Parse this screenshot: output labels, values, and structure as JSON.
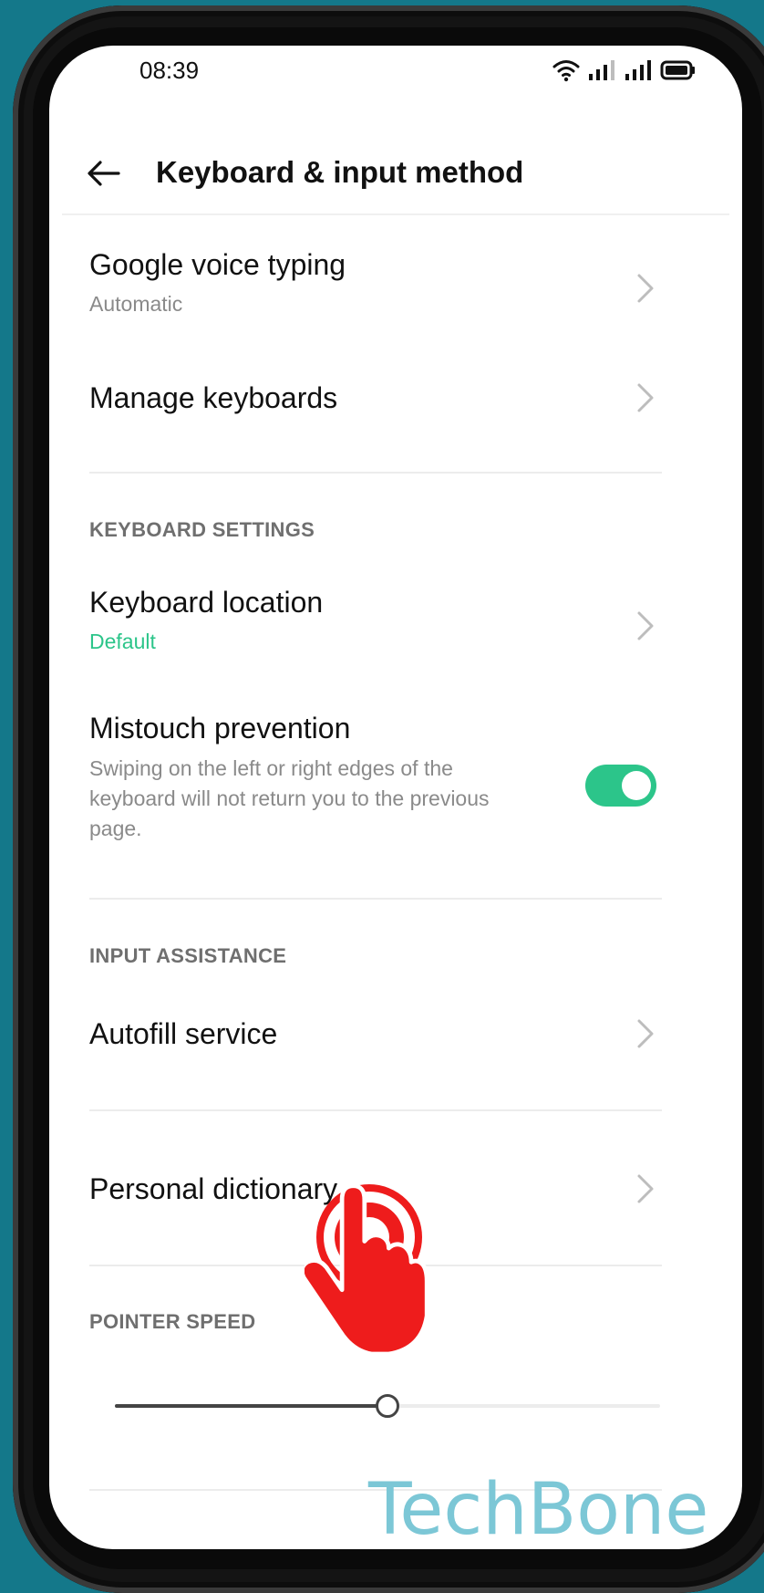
{
  "status_bar": {
    "time": "08:39"
  },
  "header": {
    "title": "Keyboard & input method"
  },
  "rows": {
    "google_voice": {
      "title": "Google voice typing",
      "subtitle": "Automatic"
    },
    "manage_keyboards": {
      "title": "Manage keyboards"
    },
    "keyboard_location": {
      "title": "Keyboard location",
      "subtitle": "Default"
    },
    "mistouch": {
      "title": "Mistouch prevention",
      "description": "Swiping on the left or right edges of the keyboard will not return you to the previous page.",
      "enabled": true
    },
    "autofill": {
      "title": "Autofill service"
    },
    "personal_dictionary": {
      "title": "Personal dictionary"
    }
  },
  "sections": {
    "keyboard_settings": "KEYBOARD SETTINGS",
    "input_assistance": "INPUT ASSISTANCE",
    "pointer_speed": "POINTER SPEED"
  },
  "pointer_speed": {
    "value_fraction": 0.5
  },
  "colors": {
    "accent": "#2cc58a",
    "frame_background": "#14788a",
    "tap_indicator": "#ee1c1c",
    "watermark": "#7cc7d6"
  },
  "icons": {
    "back": "arrow-left-icon",
    "chevron": "chevron-right-icon",
    "wifi": "wifi-icon",
    "signal": "signal-icon",
    "battery": "battery-icon",
    "tap_hand": "tap-hand-icon"
  },
  "watermark": {
    "text": "TechBone"
  }
}
